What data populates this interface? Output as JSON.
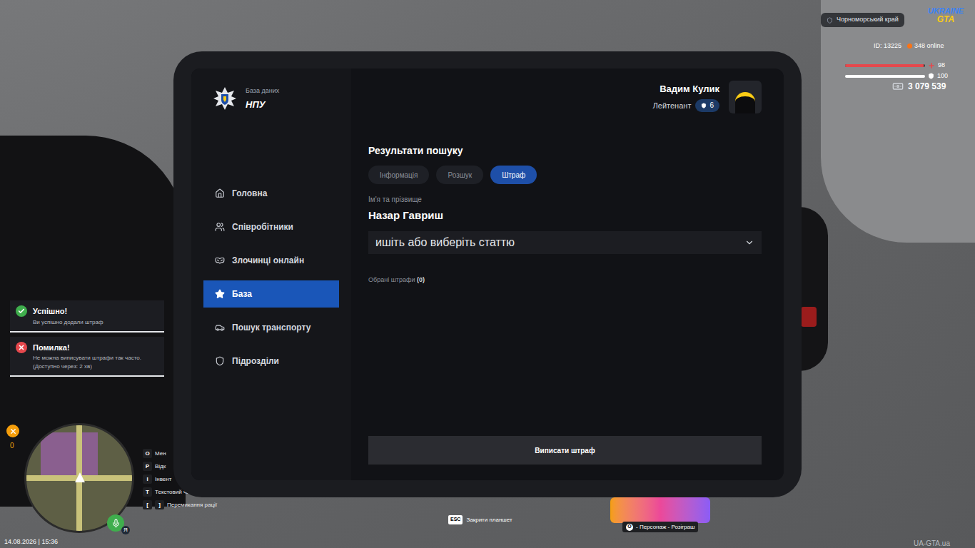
{
  "hud": {
    "region": "Чорноморський край",
    "logo": {
      "line1": "UKRAINE",
      "line2": "GTA"
    },
    "id": "ID: 13225",
    "online": "348 online",
    "health": {
      "value": "98",
      "level": 0.98
    },
    "armor": {
      "value": "100",
      "level": 1
    },
    "money": "3 079 539"
  },
  "tablet": {
    "logo": {
      "caption": "База даних",
      "title": "НПУ"
    },
    "user": {
      "name": "Вадим Кулик",
      "rank": "Лейтенант",
      "level": "6"
    },
    "nav": [
      {
        "label": "Головна",
        "selected": false
      },
      {
        "label": "Співробітники",
        "selected": false
      },
      {
        "label": "Злочинці онлайн",
        "selected": false
      },
      {
        "label": "База",
        "selected": true
      },
      {
        "label": "Пошук транспорту",
        "selected": false
      },
      {
        "label": "Підрозділи",
        "selected": false
      }
    ],
    "heading": "Результати пошуку",
    "tabs": [
      {
        "label": "Інформація",
        "selected": false
      },
      {
        "label": "Розшук",
        "selected": false
      },
      {
        "label": "Штраф",
        "selected": true
      }
    ],
    "name_label": "Ім'я та прізвище",
    "name": "Назар Гавриш",
    "article_select": {
      "placeholder": "ишіть або виберіть статтю"
    },
    "selected_fines": {
      "label": "Обрані штрафи",
      "count": "(0)"
    },
    "submit": "Виписати штраф"
  },
  "notifications": [
    {
      "kind": "success",
      "title": "Успішно!",
      "lines": [
        "Ви успішно додали штраф"
      ]
    },
    {
      "kind": "error",
      "title": "Помилка!",
      "lines": [
        "Не можна виписувати штрафи так часто.",
        "(Доступно через: 2 хв)"
      ]
    }
  ],
  "minimap": {
    "counter": "0"
  },
  "key_hints": [
    {
      "keys": [
        "O"
      ],
      "label": "Мен"
    },
    {
      "keys": [
        "P"
      ],
      "label": "Відк"
    },
    {
      "keys": [
        "I"
      ],
      "label": "Інвент"
    },
    {
      "keys": [
        "T"
      ],
      "label": "Текстовий чат"
    },
    {
      "keys": [
        "[",
        "]"
      ],
      "label": "Перемикання рації"
    }
  ],
  "voice": {
    "badge": "Я"
  },
  "datetime": "14.08.2026 | 15:36",
  "esc_hint": {
    "key": "ESC",
    "label": "Закрити планшет"
  },
  "promo": {
    "hint_key": "O",
    "hint": "- Персонаж - Розіграш"
  },
  "watermark": "UA-GTA.ua"
}
